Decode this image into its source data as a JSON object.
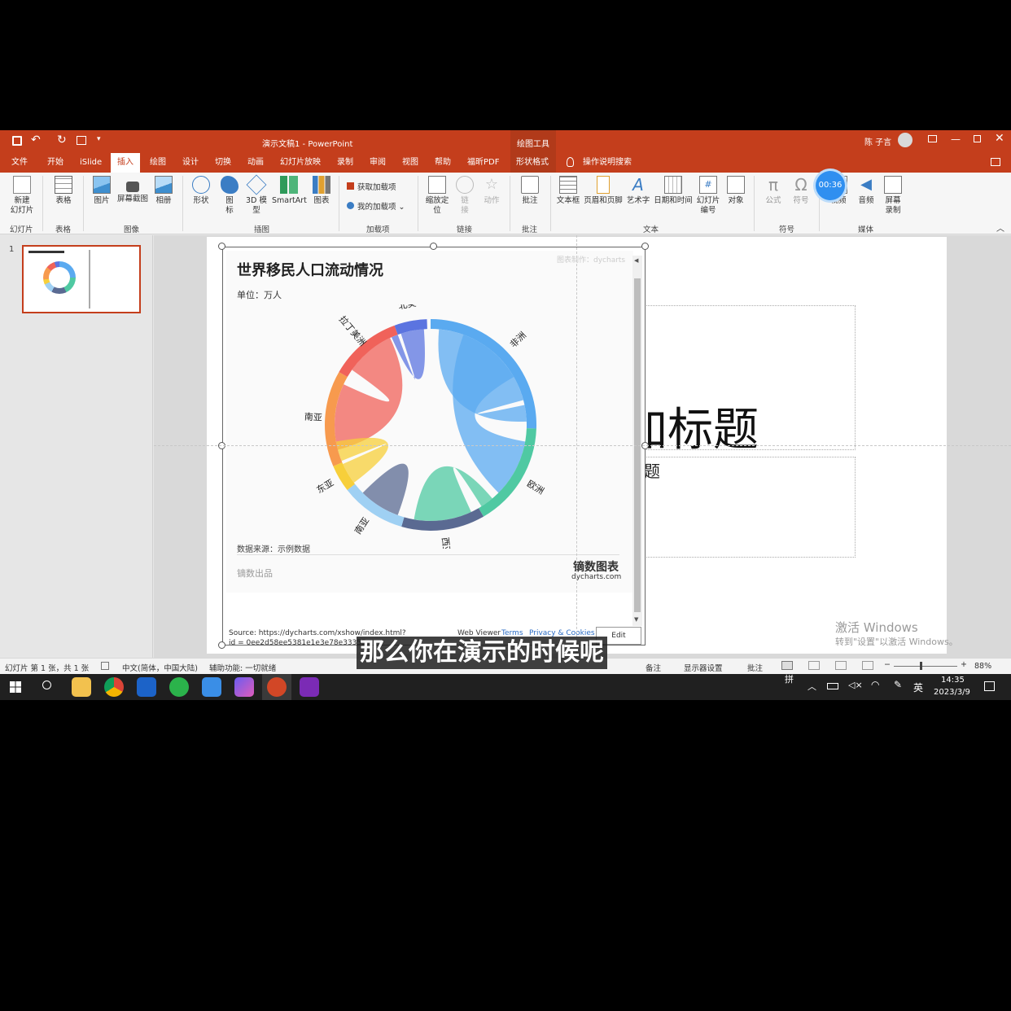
{
  "window": {
    "title": "演示文稿1 - PowerPoint",
    "context_group": "绘图工具",
    "user": "陈 子言",
    "quick_access": [
      "save",
      "undo",
      "redo",
      "present-from-start",
      "more"
    ]
  },
  "tabs": [
    "文件",
    "开始",
    "iSlide",
    "插入",
    "绘图",
    "设计",
    "切换",
    "动画",
    "幻灯片放映",
    "录制",
    "审阅",
    "视图",
    "帮助",
    "福昕PDF",
    "形状格式"
  ],
  "tab_active": "插入",
  "tell_me": "操作说明搜索",
  "ribbon": {
    "new_slide": "新建\n幻灯片",
    "table": "表格",
    "picture": "图片",
    "screenshot": "屏幕截图",
    "album": "相册",
    "shape": "形状",
    "icon": "图\n标",
    "model3d": "3D 模\n型",
    "smartart": "SmartArt",
    "chart": "图表",
    "get_addins": "获取加载项",
    "my_addins": "我的加载项",
    "zoom": "缩放定\n位",
    "link": "链\n接",
    "action": "动作",
    "comment": "批注",
    "textbox": "文本框",
    "header_footer": "页眉和页脚",
    "wordart": "艺术字",
    "datetime": "日期和时间",
    "slide_number": "幻灯片\n编号",
    "object": "对象",
    "equation": "公式",
    "symbol": "符号",
    "video": "视频",
    "audio": "音频",
    "screen_record": "屏幕\n录制",
    "timer": "00:36",
    "groups": [
      "幻灯片",
      "表格",
      "图像",
      "插图",
      "加载项",
      "链接",
      "批注",
      "文本",
      "符号",
      "媒体"
    ]
  },
  "thumbnail": {
    "number": "1"
  },
  "slide": {
    "title_partial": "加标题",
    "subtitle_partial": "题"
  },
  "embed": {
    "title": "世界移民人口流动情况",
    "unit": "单位：万人",
    "watermark": "图表制作：dycharts",
    "source": "数据来源：示例数据",
    "credit": "镝数出品",
    "brand_cn": "镝数图表",
    "brand_en": "dycharts.com",
    "viewer_source": "Source: https://dycharts.com/xshow/index.html?",
    "viewer_source_line2": "id = 0ee2d58ee5381e1e3e78e33355",
    "web_viewer": "Web Viewer",
    "terms": "Terms",
    "privacy": "Privacy & Cookies",
    "edit": "Edit"
  },
  "chart_data": {
    "type": "chord",
    "title": "世界移民人口流动情况",
    "unit": "单位：万人",
    "regions": [
      {
        "name": "非洲",
        "color": "#5aaaf0"
      },
      {
        "name": "欧洲",
        "color": "#4fc9a2"
      },
      {
        "name": "西亚",
        "color": "#5a6a92"
      },
      {
        "name": "南亚",
        "color": "#9fd0f3"
      },
      {
        "name": "东亚",
        "color": "#f7cf3a"
      },
      {
        "name": "东南亚",
        "color": "#f79a4e"
      },
      {
        "name": "拉丁美洲",
        "color": "#f0625a"
      },
      {
        "name": "北美",
        "color": "#5b74e0"
      }
    ]
  },
  "subtitle_caption": "那么你在演示的时候呢",
  "windows_activation": {
    "line1": "激活 Windows",
    "line2": "转到\"设置\"以激活 Windows。"
  },
  "status": {
    "slide_info": "幻灯片 第 1 张，共 1 张",
    "language": "中文(简体，中国大陆)",
    "accessibility": "辅助功能: 一切就绪",
    "notes": "备注",
    "display_settings": "显示器设置",
    "comments": "批注",
    "zoom": "88%"
  },
  "taskbar": {
    "time": "14:35",
    "date": "2023/3/9",
    "ime": "英",
    "ime2": "拼"
  }
}
